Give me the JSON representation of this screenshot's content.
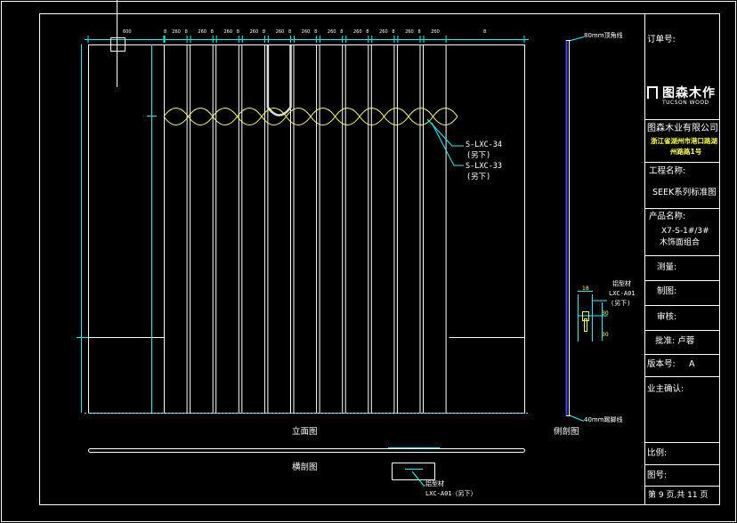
{
  "titleblock": {
    "order_no_label": "订单号:",
    "company": "图森木业有限公司",
    "address_line1": "浙江省湖州市港口路湖",
    "address_line2": "州路路1号",
    "project_label": "工程名称:",
    "project_value": "SEEK系列标准图",
    "product_label": "产品名称:",
    "product_value1": "X7-S-1#/3#",
    "product_value2": "木饰面组合",
    "measure_label": "测量:",
    "drawing_label": "制图:",
    "review_label": "审核:",
    "approve_label": "批准: 卢蓉",
    "version_label": "版本号:",
    "version_value": "A",
    "owner_label": "业主确认:",
    "scale_label": "比例:",
    "drawing_no_label": "图号:",
    "page_label": "第 9 页,共 11 页"
  },
  "logo": {
    "name": "图森木作",
    "sub": "TUCSON WOOD"
  },
  "elevation": {
    "caption": "立面图",
    "callout1_code": "S-LXC-34",
    "callout1_note": "(另下)",
    "callout2_code": "S-LXC-33",
    "callout2_note": "(另下)",
    "top_dims": [
      "600",
      "8",
      "260",
      "8",
      "260",
      "8",
      "260",
      "8",
      "260",
      "8",
      "260",
      "8",
      "260",
      "8",
      "260",
      "8",
      "260",
      "8",
      "260",
      "8",
      "260",
      "8",
      "260",
      "8",
      "260",
      "8",
      "600"
    ]
  },
  "side": {
    "caption": "侧剖图",
    "top_note": "80mm顶角线",
    "bottom_note": "40mm踢脚线",
    "detail_label": "铝型材",
    "detail_code": "LXC-A01",
    "detail_note": "(另下)",
    "dim_top": "18",
    "dim_a": "30",
    "dim_b": "30"
  },
  "plan": {
    "caption": "横剖图",
    "detail_label": "铝型材",
    "detail_code": "LXC-A01（另下）"
  },
  "colors": {
    "line": "#ffffff",
    "dim": "#00ffff",
    "curve": "#ffff66",
    "side_rail": "#4444ff"
  }
}
